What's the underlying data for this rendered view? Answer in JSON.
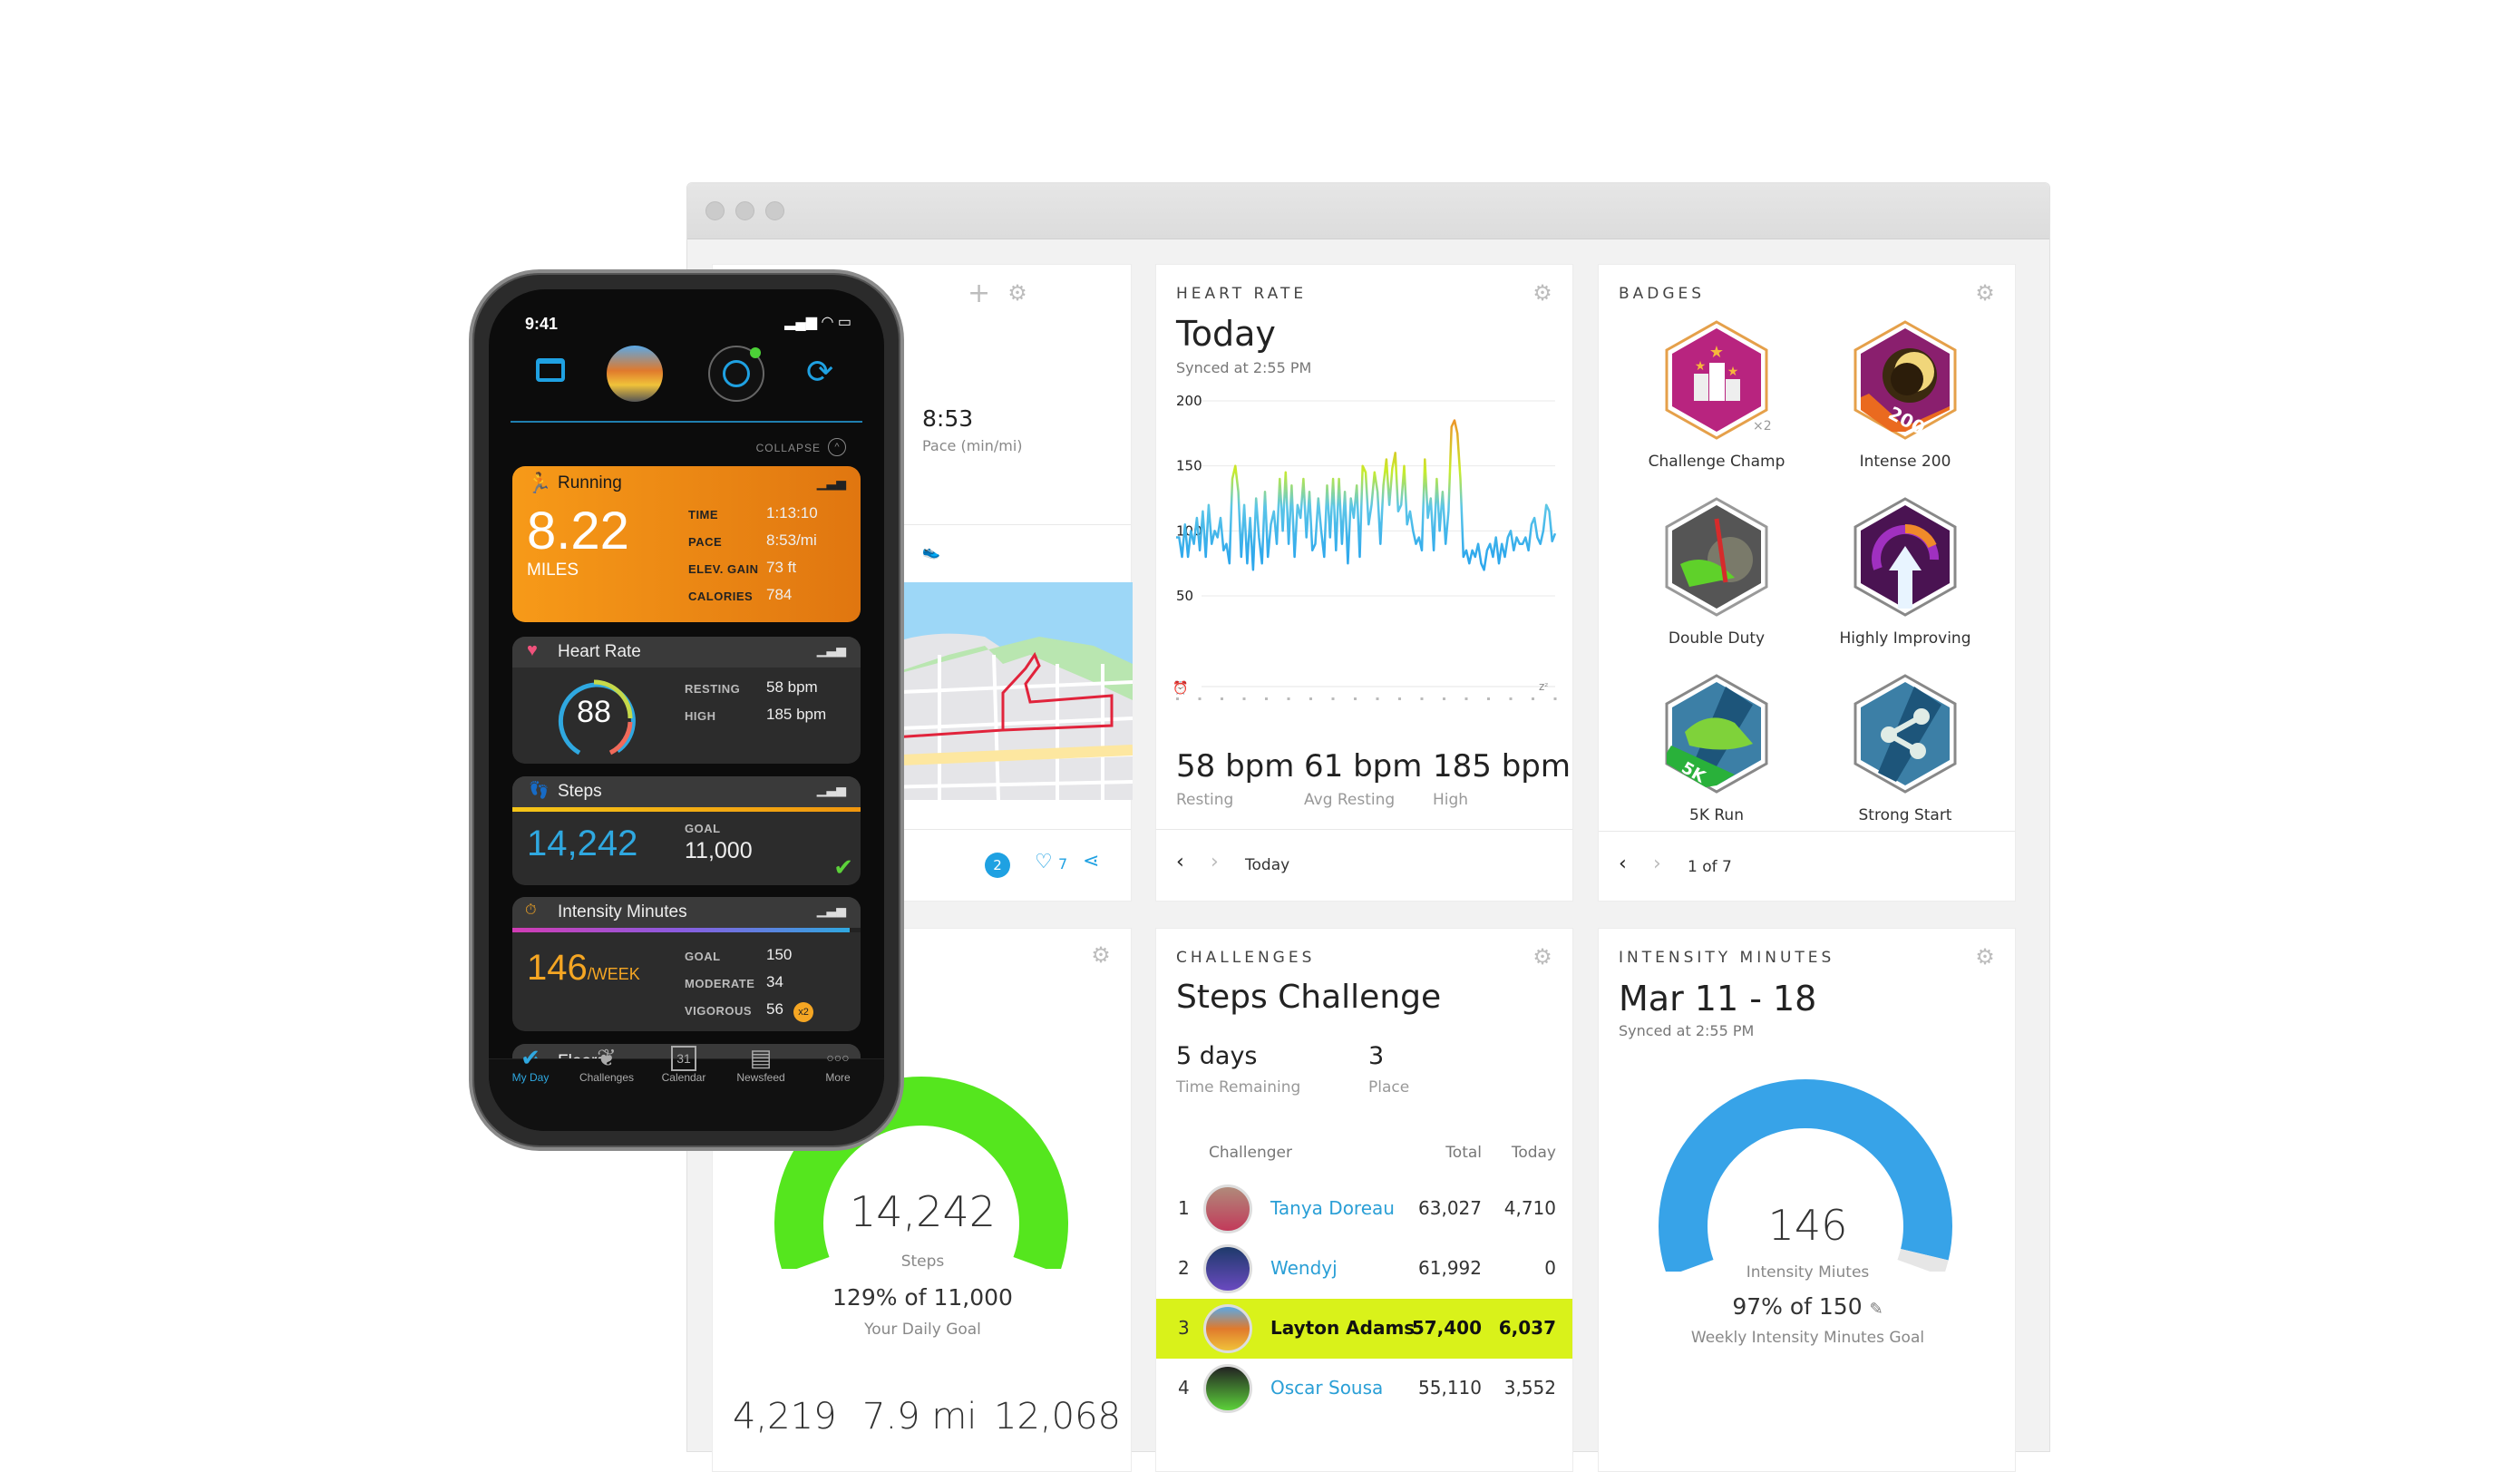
{
  "window": {
    "traffic_lights": [
      "close",
      "minimize",
      "maximize"
    ]
  },
  "activity_card": {
    "pace_value": "8:53",
    "pace_label": "Pace (min/mi)",
    "activity_icon": "shoe-icon",
    "comments_count": "2",
    "likes_count": "7"
  },
  "heart_rate": {
    "title": "HEART RATE",
    "heading": "Today",
    "synced": "Synced at 2:55 PM",
    "stats": [
      {
        "value": "58 bpm",
        "label": "Resting"
      },
      {
        "value": "61 bpm",
        "label": "Avg Resting"
      },
      {
        "value": "185 bpm",
        "label": "High"
      }
    ],
    "footer_label": "Today"
  },
  "badges": {
    "title": "BADGES",
    "items": [
      {
        "label": "Challenge Champ",
        "multiplier": "×2"
      },
      {
        "label": "Intense 200",
        "banner": "200"
      },
      {
        "label": "Double Duty"
      },
      {
        "label": "Highly Improving"
      },
      {
        "label": "5K Run",
        "banner": "5K"
      },
      {
        "label": "Strong Start"
      }
    ],
    "pager": "1 of 7"
  },
  "steps_card": {
    "value": "14,242",
    "label": "Steps",
    "percent_text": "129% of 11,000",
    "goal_label": "Your Daily Goal",
    "goal_fraction": 1.0,
    "bottom_stats": [
      "4,219",
      "7.9 mi",
      "12,068"
    ],
    "color": "#55e61e"
  },
  "challenges": {
    "title": "CHALLENGES",
    "heading": "Steps Challenge",
    "time_remaining_value": "5 days",
    "time_remaining_label": "Time Remaining",
    "place_value": "3",
    "place_label": "Place",
    "columns": [
      "Challenger",
      "Total",
      "Today"
    ],
    "rows": [
      {
        "rank": "1",
        "name": "Tanya Doreau",
        "total": "63,027",
        "today": "4,710",
        "me": false
      },
      {
        "rank": "2",
        "name": "Wendyj",
        "total": "61,992",
        "today": "0",
        "me": false
      },
      {
        "rank": "3",
        "name": "Layton Adams",
        "total": "57,400",
        "today": "6,037",
        "me": true
      },
      {
        "rank": "4",
        "name": "Oscar Sousa",
        "total": "55,110",
        "today": "3,552",
        "me": false
      }
    ],
    "highlight_color": "#d9f21a"
  },
  "intensity": {
    "title": "INTENSITY MINUTES",
    "heading": "Mar 11 - 18",
    "synced": "Synced at 2:55 PM",
    "value": "146",
    "label": "Intensity Miutes",
    "percent_text": "97% of 150",
    "goal_label": "Weekly Intensity Minutes Goal",
    "goal_fraction": 0.97,
    "color": "#37a3e8"
  },
  "chart_data": {
    "type": "line",
    "title": "Heart Rate — Today",
    "xlabel": "",
    "ylabel": "bpm",
    "ylim": [
      0,
      200
    ],
    "yticks": [
      50,
      100,
      150,
      200
    ],
    "grid": true,
    "series": [
      {
        "name": "Heart rate",
        "values": [
          95,
          95,
          80,
          105,
          80,
          100,
          90,
          110,
          85,
          115,
          80,
          120,
          90,
          100,
          95,
          110,
          85,
          90,
          75,
          140,
          150,
          130,
          80,
          120,
          75,
          110,
          70,
          125,
          95,
          75,
          130,
          80,
          105,
          115,
          90,
          140,
          100,
          145,
          90,
          135,
          80,
          120,
          110,
          140,
          95,
          130,
          85,
          90,
          125,
          100,
          80,
          135,
          95,
          140,
          85,
          140,
          90,
          130,
          75,
          125,
          110,
          135,
          80,
          150,
          145,
          105,
          120,
          145,
          130,
          90,
          135,
          155,
          120,
          148,
          160,
          115,
          120,
          150,
          105,
          115,
          100,
          90,
          95,
          85,
          155,
          110,
          125,
          85,
          140,
          100,
          130,
          90,
          115,
          180,
          185,
          175,
          140,
          80,
          85,
          75,
          85,
          80,
          90,
          75,
          70,
          85,
          90,
          80,
          95,
          75,
          90,
          80,
          95,
          100,
          85,
          95,
          90,
          90,
          95,
          85,
          105,
          110,
          95,
          90,
          100,
          120,
          115,
          92,
          98
        ]
      }
    ],
    "summary": [
      {
        "label": "Resting",
        "value": 58
      },
      {
        "label": "Avg Resting",
        "value": 61
      },
      {
        "label": "High",
        "value": 185
      }
    ]
  },
  "phone": {
    "time": "9:41",
    "collapse_label": "COLLAPSE",
    "running": {
      "title": "Running",
      "distance": "8.22",
      "unit": "MILES",
      "stats": [
        {
          "label": "TIME",
          "value": "1:13:10"
        },
        {
          "label": "PACE",
          "value": "8:53/mi"
        },
        {
          "label": "ELEV. GAIN",
          "value": "73 ft"
        },
        {
          "label": "CALORIES",
          "value": "784"
        }
      ]
    },
    "heart_rate": {
      "title": "Heart Rate",
      "current": "88",
      "stats": [
        {
          "label": "RESTING",
          "value": "58 bpm"
        },
        {
          "label": "HIGH",
          "value": "185 bpm"
        }
      ]
    },
    "steps": {
      "title": "Steps",
      "value": "14,242",
      "goal_label": "GOAL",
      "goal_value": "11,000"
    },
    "intensity": {
      "title": "Intensity Minutes",
      "value": "146",
      "unit": "/WEEK",
      "progress_fraction": 0.97,
      "stats": [
        {
          "label": "GOAL",
          "value": "150"
        },
        {
          "label": "MODERATE",
          "value": "34"
        },
        {
          "label": "VIGOROUS",
          "value": "56"
        }
      ],
      "vigorous_badge": "x2"
    },
    "floors": {
      "title": "Floors"
    },
    "tabs": [
      {
        "label": "My Day",
        "icon": "check-icon",
        "active": true
      },
      {
        "label": "Challenges",
        "icon": "laurel-icon",
        "active": false
      },
      {
        "label": "Calendar",
        "icon": "calendar-icon",
        "active": false
      },
      {
        "label": "Newsfeed",
        "icon": "newsfeed-icon",
        "active": false
      },
      {
        "label": "More",
        "icon": "more-icon",
        "active": false
      }
    ],
    "calendar_day": "31"
  }
}
